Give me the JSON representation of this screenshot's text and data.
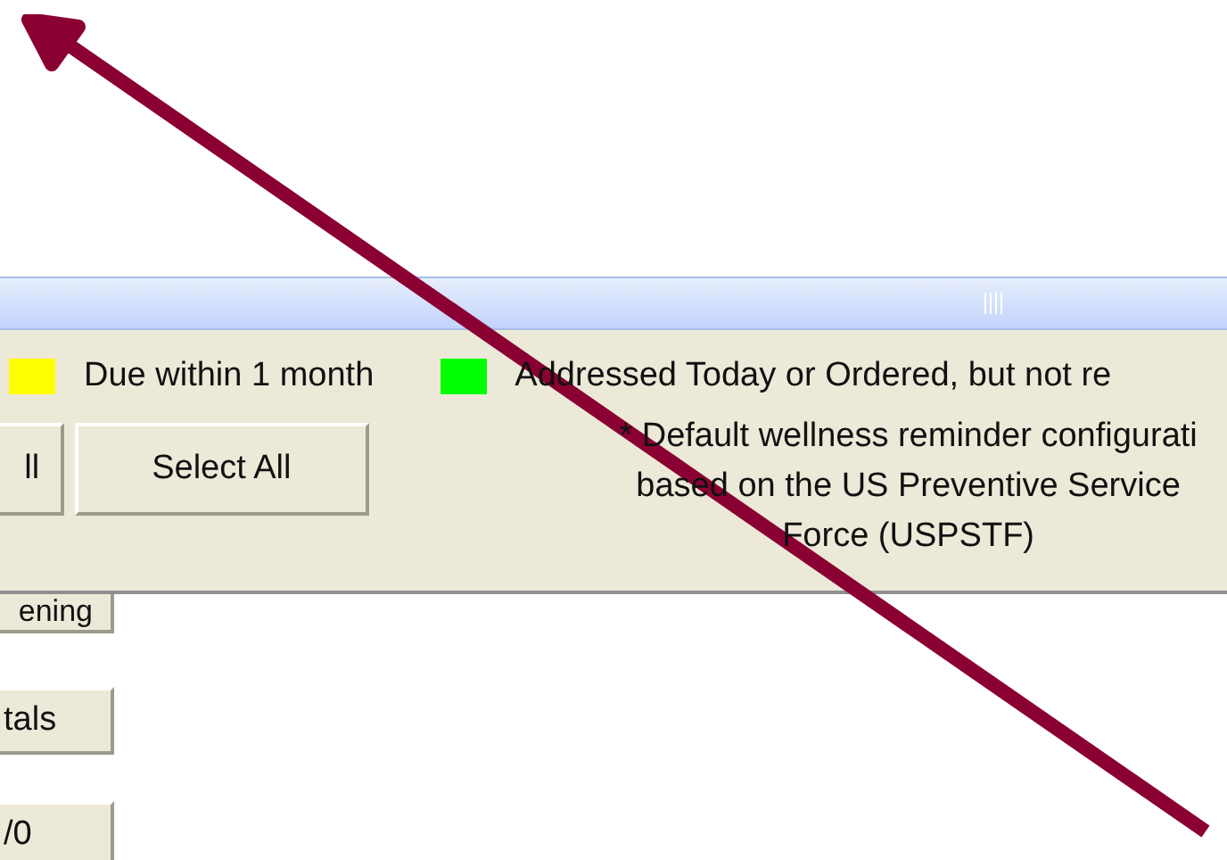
{
  "legend": [
    {
      "label": "Due within 1 month",
      "color": "#ffff00"
    },
    {
      "label": "Addressed Today or Ordered, but not re",
      "color": "#00ff00"
    }
  ],
  "panel_buttons": [
    {
      "label": "ll"
    },
    {
      "label": "Select All"
    }
  ],
  "note_lines": [
    "* Default wellness reminder configurati",
    "based on the US Preventive Service",
    "Force (USPSTF)"
  ],
  "side_buttons": [
    {
      "label": "ening",
      "partly_covered": true
    },
    {
      "label": "tals",
      "partly_covered": false
    },
    {
      "label": "/0",
      "partly_covered": false
    }
  ]
}
